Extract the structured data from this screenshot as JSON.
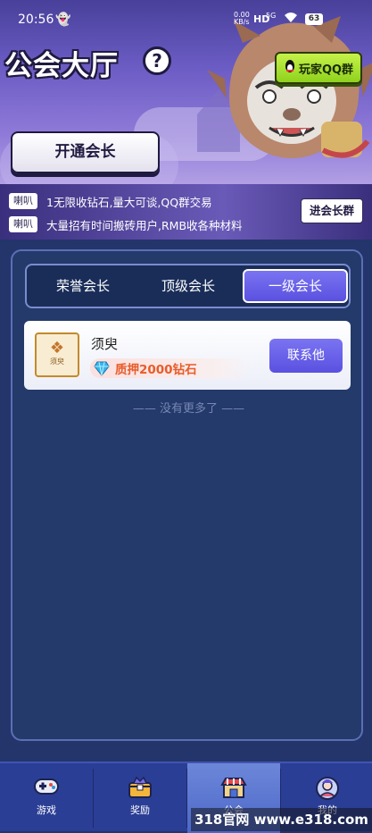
{
  "status_bar": {
    "time": "20:56",
    "ghost_icon": "ghost-icon",
    "net_speed": "0.00",
    "net_unit": "KB/s",
    "hd_label": "HD",
    "signal_label": "5G",
    "battery": "63"
  },
  "header": {
    "title": "公会大厅",
    "help_icon": "?",
    "qq_button": "玩家QQ群",
    "open_button": "开通会长"
  },
  "notice": {
    "tag_label": "喇叭",
    "lines": [
      "1无限收钻石,量大可谈,QQ群交易",
      "大量招有时间搬砖用户,RMB收各种材料"
    ],
    "join_button": "进会长群"
  },
  "tabs": {
    "items": [
      "荣誉会长",
      "顶级会长",
      "一级会长"
    ],
    "selected": "一级会长"
  },
  "leaders": [
    {
      "name": "须臾",
      "logo_text": "须臾",
      "deposit": "质押2000钻石",
      "contact_button": "联系他"
    }
  ],
  "list_end": "—— 没有更多了 ——",
  "bottom_nav": {
    "items": [
      {
        "label": "游戏",
        "icon": "gamepad-icon"
      },
      {
        "label": "奖励",
        "icon": "reward-chest-icon"
      },
      {
        "label": "公会",
        "icon": "guild-shop-icon"
      },
      {
        "label": "我的",
        "icon": "profile-avatar-icon"
      }
    ],
    "active": "公会"
  },
  "watermark": "318官网 www.e318.com",
  "colors": {
    "accent": "#5a50e0",
    "qq_green": "#8fd21d",
    "deposit_orange": "#e85c2a",
    "panel_bg": "#233a6a"
  }
}
